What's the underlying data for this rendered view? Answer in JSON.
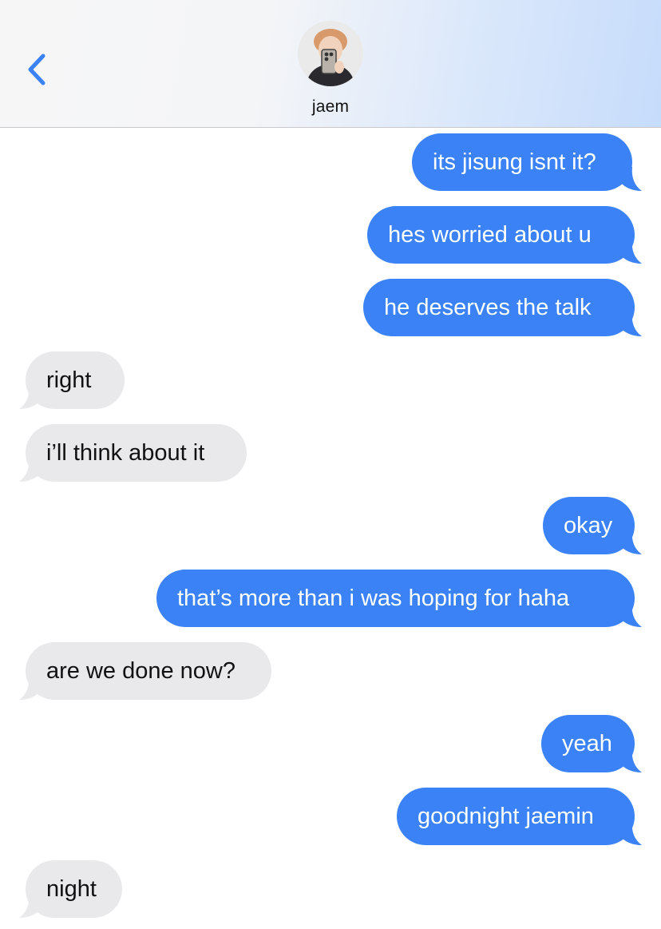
{
  "header": {
    "contact_name": "jaem",
    "back_icon": "chevron-left-icon",
    "accent_color": "#3a82f6"
  },
  "colors": {
    "sent_bubble": "#3a82f6",
    "received_bubble": "#e9e9eb"
  },
  "messages": [
    {
      "direction": "sent",
      "text": "its jisung isnt it?"
    },
    {
      "direction": "sent",
      "text": "hes worried about u"
    },
    {
      "direction": "sent",
      "text": "he deserves the talk"
    },
    {
      "direction": "received",
      "text": "right"
    },
    {
      "direction": "received",
      "text": "i’ll think about it"
    },
    {
      "direction": "sent",
      "text": "okay"
    },
    {
      "direction": "sent",
      "text": "that’s more than i was hoping for haha"
    },
    {
      "direction": "received",
      "text": "are we done now?"
    },
    {
      "direction": "sent",
      "text": "yeah"
    },
    {
      "direction": "sent",
      "text": "goodnight jaemin"
    },
    {
      "direction": "received",
      "text": "night"
    }
  ]
}
